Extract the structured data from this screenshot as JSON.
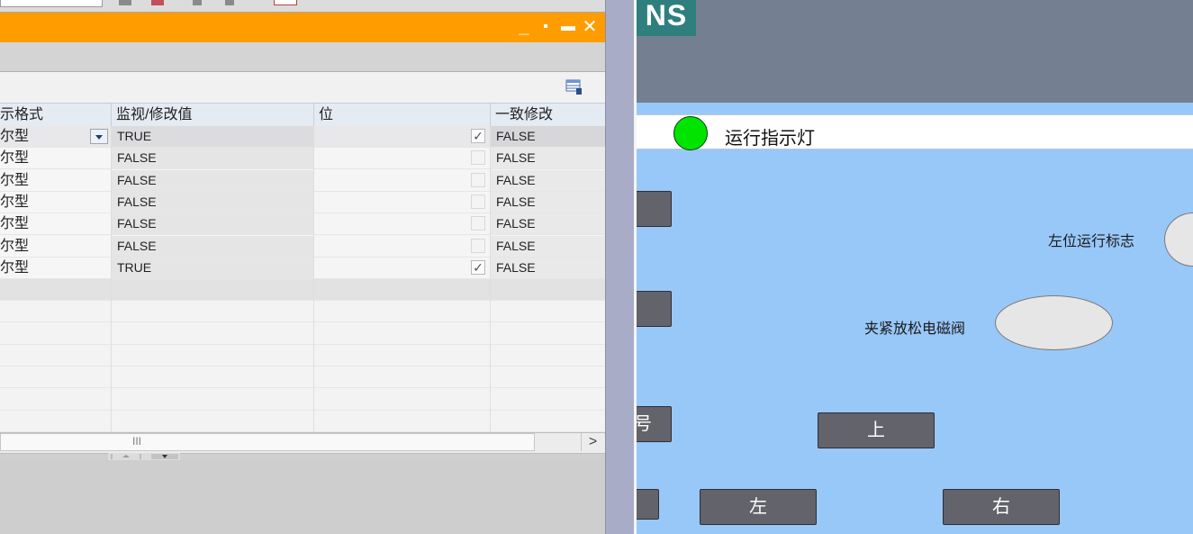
{
  "window": {
    "buttons": [
      "_",
      "▪",
      "▬",
      "✕"
    ]
  },
  "table": {
    "headers": [
      "示格式",
      "监视/修改值",
      "位",
      "一致修改"
    ],
    "rows": [
      {
        "format": "尔型",
        "value": "TRUE",
        "bit": true,
        "consistent": "FALSE",
        "selected": true
      },
      {
        "format": "尔型",
        "value": "FALSE",
        "bit": false,
        "consistent": "FALSE",
        "selected": false
      },
      {
        "format": "尔型",
        "value": "FALSE",
        "bit": false,
        "consistent": "FALSE",
        "selected": false
      },
      {
        "format": "尔型",
        "value": "FALSE",
        "bit": false,
        "consistent": "FALSE",
        "selected": false
      },
      {
        "format": "尔型",
        "value": "FALSE",
        "bit": false,
        "consistent": "FALSE",
        "selected": false
      },
      {
        "format": "尔型",
        "value": "FALSE",
        "bit": false,
        "consistent": "FALSE",
        "selected": false
      },
      {
        "format": "尔型",
        "value": "TRUE",
        "bit": true,
        "consistent": "FALSE",
        "selected": false
      }
    ],
    "scroll_grip": "III",
    "scroll_right": ">"
  },
  "hmi": {
    "logo_text": "NS",
    "run_indicator_label": "运行指示灯",
    "left_position_label": "左位运行标志",
    "clamp_valve_label": "夹紧放松电磁阀",
    "partial_button_label": "号",
    "up_button": "上",
    "left_button": "左",
    "right_button": "右",
    "colors": {
      "header": "#747f92",
      "background": "#98c8f8",
      "run_lamp": "#00e400",
      "button": "#63636b",
      "window_bar": "#ff9d00"
    }
  }
}
